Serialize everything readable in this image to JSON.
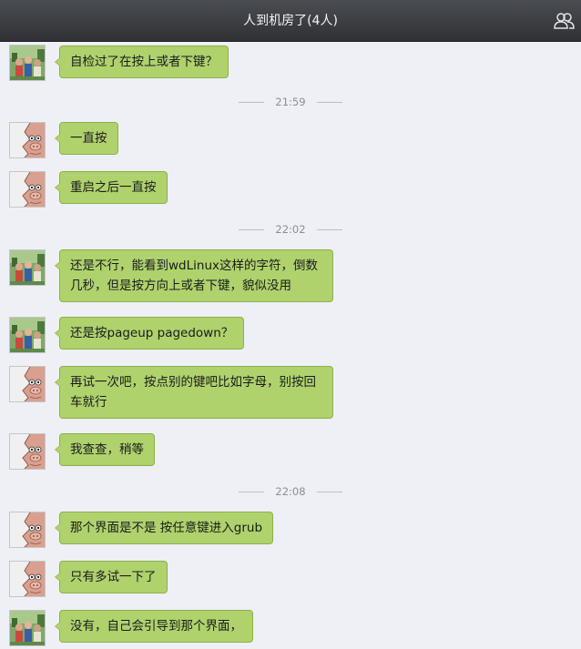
{
  "header": {
    "title": "人到机房了(4人)",
    "members_icon": "members-icon"
  },
  "timestamps": [
    "21:59",
    "22:02",
    "22:08"
  ],
  "messages": [
    {
      "avatar": "photo",
      "text": "自检过了在按上或者下键？"
    },
    {
      "avatar": "pig",
      "text": "一直按"
    },
    {
      "avatar": "pig",
      "text": "重启之后一直按"
    },
    {
      "avatar": "photo",
      "text": "还是不行，能看到wdLinux这样的字符，倒数几秒，但是按方向上或者下键，貌似没用"
    },
    {
      "avatar": "photo",
      "text": "还是按pageup pagedown？"
    },
    {
      "avatar": "pig",
      "text": "再试一次吧，按点别的键吧比如字母，别按回车就行"
    },
    {
      "avatar": "pig",
      "text": "我查查，稍等"
    },
    {
      "avatar": "pig",
      "text": "那个界面是不是 按任意键进入grub"
    },
    {
      "avatar": "pig",
      "text": "只有多试一下了"
    },
    {
      "avatar": "photo",
      "text": "没有，自己会引导到那个界面，"
    }
  ],
  "colors": {
    "bubble": "#afd26d",
    "bubble_border": "#8db04b",
    "background": "#eef0f5",
    "titlebar": "#3b3d41"
  }
}
